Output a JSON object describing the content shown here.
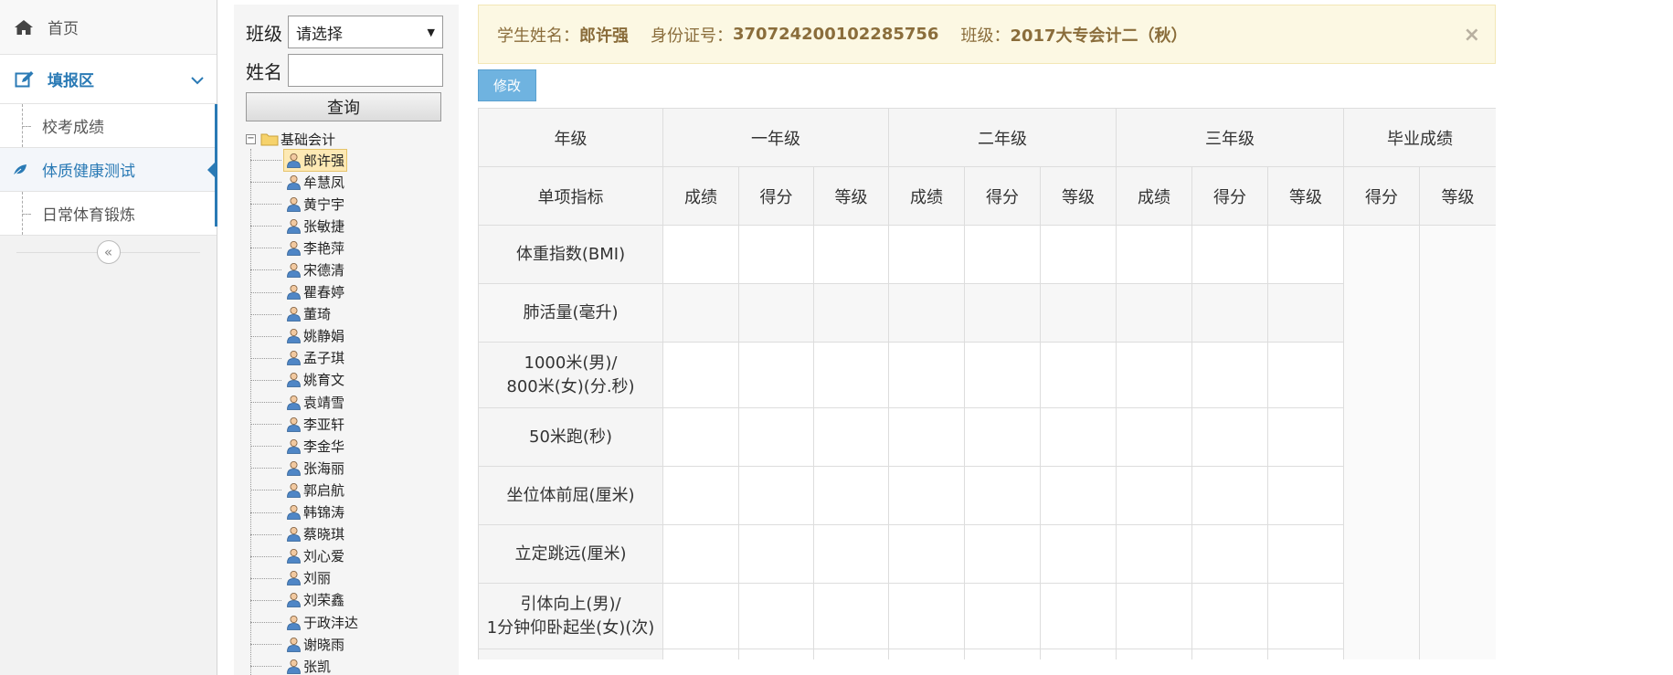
{
  "sidebar": {
    "home_label": "首页",
    "section_label": "填报区",
    "items": [
      {
        "label": "校考成绩"
      },
      {
        "label": "体质健康测试"
      },
      {
        "label": "日常体育锻炼"
      }
    ],
    "collapse_glyph": "«"
  },
  "filter": {
    "class_label": "班级",
    "class_selected": "请选择",
    "name_label": "姓名",
    "name_value": "",
    "query_label": "查询"
  },
  "tree": {
    "root_label": "基础会计",
    "students": [
      "郎许强",
      "牟慧凤",
      "黄宁宇",
      "张敏捷",
      "李艳萍",
      "宋德清",
      "瞿春婷",
      "董琦",
      "姚静娟",
      "孟子琪",
      "姚育文",
      "袁靖雪",
      "李亚轩",
      "李金华",
      "张海丽",
      "郭启航",
      "韩锦涛",
      "蔡晓琪",
      "刘心爱",
      "刘丽",
      "刘荣鑫",
      "于政沣达",
      "谢晓雨",
      "张凯"
    ],
    "selected_index": 0
  },
  "alert": {
    "name_label": "学生姓名：",
    "name_value": "郎许强",
    "id_label": "身份证号：",
    "id_value": "370724200102285756",
    "class_label": "班级：",
    "class_value": "2017大专会计二（秋）",
    "close_glyph": "×"
  },
  "edit_label": "修改",
  "table": {
    "header1": {
      "grade": "年级",
      "year1": "一年级",
      "year2": "二年级",
      "year3": "三年级",
      "final": "毕业成绩"
    },
    "header2": {
      "item": "单项指标",
      "score": "成绩",
      "points": "得分",
      "level": "等级"
    },
    "rows": [
      {
        "label": "体重指数(BMI)"
      },
      {
        "label": "肺活量(毫升)"
      },
      {
        "label_line1": "1000米(男)/",
        "label_line2": "800米(女)(分.秒)"
      },
      {
        "label": "50米跑(秒)"
      },
      {
        "label": "坐位体前屈(厘米)"
      },
      {
        "label": "立定跳远(厘米)"
      },
      {
        "label_line1": "引体向上(男)/",
        "label_line2": "1分钟仰卧起坐(女)(次)"
      }
    ]
  },
  "colors": {
    "accent": "#2a7ab5",
    "alert_bg": "#fcf8e3",
    "alert_text": "#8a6d3b",
    "button_blue": "#6fb3e0"
  }
}
